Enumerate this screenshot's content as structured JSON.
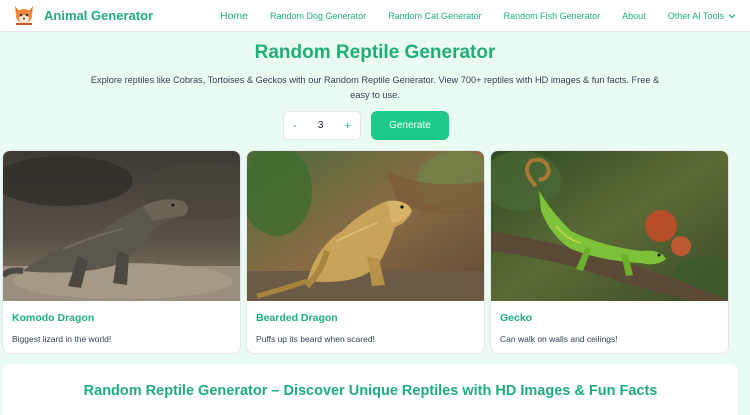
{
  "brand": {
    "name": "Animal Generator",
    "logo": "fox-logo"
  },
  "nav": {
    "home": "Home",
    "items": [
      "Random Dog Generator",
      "Random Cat Generator",
      "Random Fish Generator",
      "About"
    ],
    "more": "Other AI Tools"
  },
  "hero": {
    "title": "Random Reptile Generator",
    "description": "Explore reptiles like Cobras, Tortoises & Geckos with our Random Reptile Generator. View 700+ reptiles with HD images & fun facts. Free & easy to use."
  },
  "stepper": {
    "minus": "-",
    "value": "3",
    "plus": "+"
  },
  "generate_label": "Generate",
  "cards": [
    {
      "title": "Komodo Dragon",
      "fact": "Biggest lizard in the world!",
      "image": "komodo-dragon-photo"
    },
    {
      "title": "Bearded Dragon",
      "fact": "Puffs up its beard when scared!",
      "image": "bearded-dragon-photo"
    },
    {
      "title": "Gecko",
      "fact": "Can walk on walls and ceilings!",
      "image": "gecko-photo"
    }
  ],
  "section": {
    "title": "Random Reptile Generator – Discover Unique Reptiles with HD Images & Fun Facts"
  },
  "colors": {
    "accent": "#1fae7a",
    "button": "#1ec88a",
    "background": "#eafbf3"
  }
}
